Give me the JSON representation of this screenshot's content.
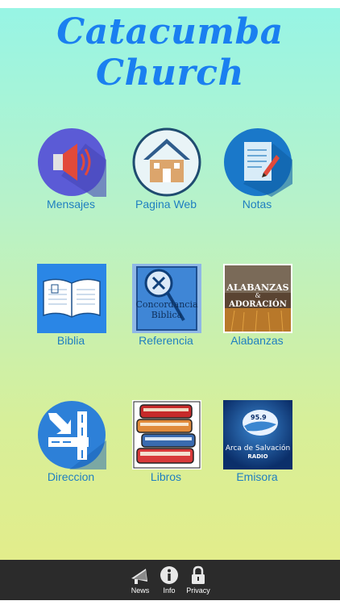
{
  "app": {
    "title": "Catacumba Church"
  },
  "grid": {
    "items": [
      {
        "label": "Mensajes",
        "icon": "speaker-icon"
      },
      {
        "label": "Pagina Web",
        "icon": "house-icon"
      },
      {
        "label": "Notas",
        "icon": "notes-icon"
      },
      {
        "label": "Biblia",
        "icon": "bible-icon"
      },
      {
        "label": "Referencia",
        "icon": "concordance-icon"
      },
      {
        "label": "Alabanzas",
        "icon": "worship-icon"
      },
      {
        "label": "Direccion",
        "icon": "directions-icon"
      },
      {
        "label": "Libros",
        "icon": "books-icon"
      },
      {
        "label": "Emisora",
        "icon": "radio-icon"
      }
    ],
    "image_text": {
      "referencia_line1": "Concordancia",
      "referencia_line2": "Biblica",
      "alabanzas_line1": "ALABANZAS",
      "alabanzas_amp": "&",
      "alabanzas_line2": "ADORACIÓN",
      "emisora_line1": "Arca de Salvación",
      "emisora_line2": "RADIO",
      "emisora_freq": "95.9"
    }
  },
  "tabbar": {
    "tabs": [
      {
        "label": "News",
        "icon": "megaphone-icon"
      },
      {
        "label": "Info",
        "icon": "info-icon"
      },
      {
        "label": "Privacy",
        "icon": "lock-icon"
      }
    ]
  },
  "colors": {
    "title": "#1a7ff0",
    "label": "#1f7fc0",
    "tabbar": "#2b2b2b",
    "gradient_top": "#96f5e6",
    "gradient_bottom": "#e6ec86"
  }
}
